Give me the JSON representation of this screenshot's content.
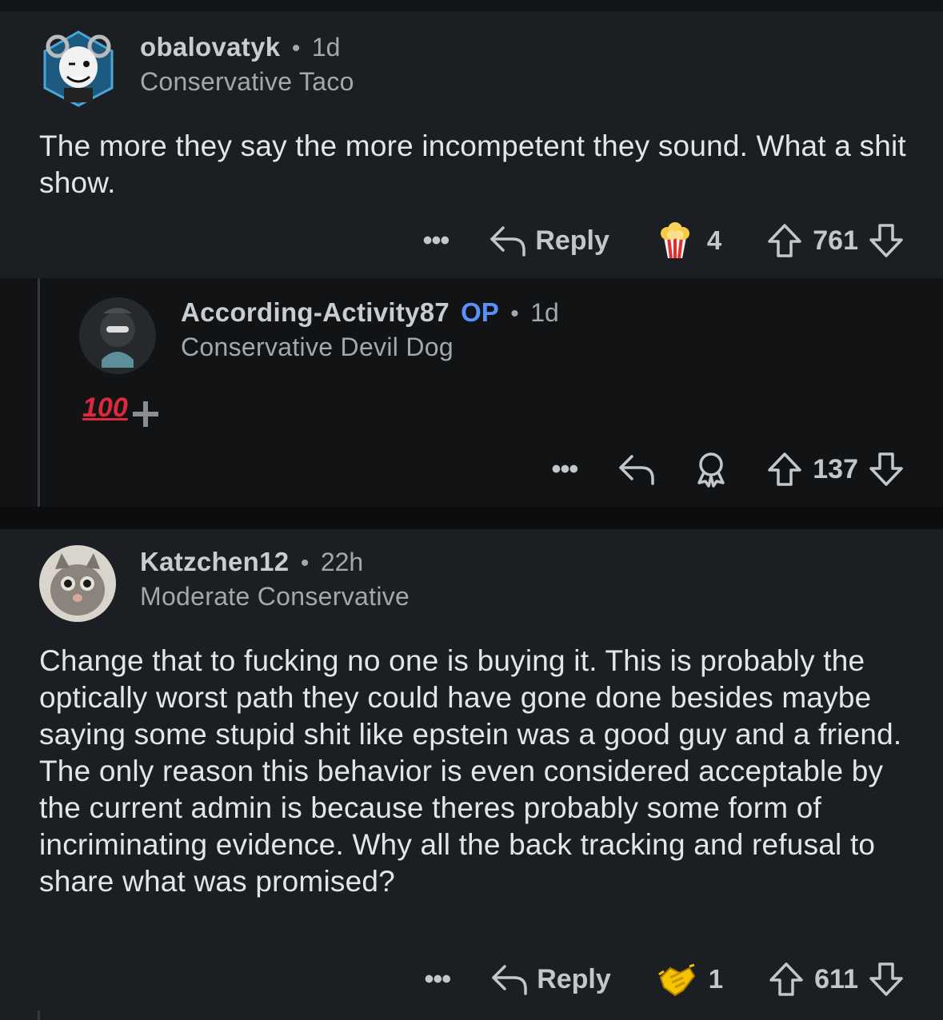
{
  "comments": [
    {
      "username": "obalovatyk",
      "age": "1d",
      "flair": "Conservative Taco",
      "body": "The more they say the more incompetent they sound. What a shit show.",
      "actions": {
        "more": "•••",
        "reply": "Reply",
        "award_count": "4",
        "votes": "761"
      }
    },
    {
      "username": "According-Activity87",
      "op_badge": "OP",
      "age": "1d",
      "flair": "Conservative Devil Dog",
      "emoji_flair": "100",
      "actions": {
        "more": "•••",
        "votes": "137"
      }
    },
    {
      "username": "Katzchen12",
      "age": "22h",
      "flair": "Moderate Conservative",
      "body": "Change that to fucking no one is buying it. This is probably the optically worst path they could have gone done besides maybe saying some stupid shit like epstein was a good guy and a friend. The only reason this behavior is even considered acceptable by the current admin is because theres probably some form of incriminating evidence. Why all the back tracking and refusal to share what was promised?",
      "actions": {
        "more": "•••",
        "reply": "Reply",
        "award_count": "1",
        "votes": "611"
      }
    }
  ],
  "colors": {
    "background": "#1b1f23",
    "nested_background": "#111315",
    "op_badge": "#5b8ff9",
    "text": "#e3e5e7",
    "muted": "#a3a8ab"
  },
  "icons": [
    "reply-arrow-icon",
    "popcorn-award-icon",
    "upvote-arrow-icon",
    "downvote-arrow-icon",
    "award-ribbon-icon",
    "handshake-award-icon",
    "plus-icon"
  ]
}
